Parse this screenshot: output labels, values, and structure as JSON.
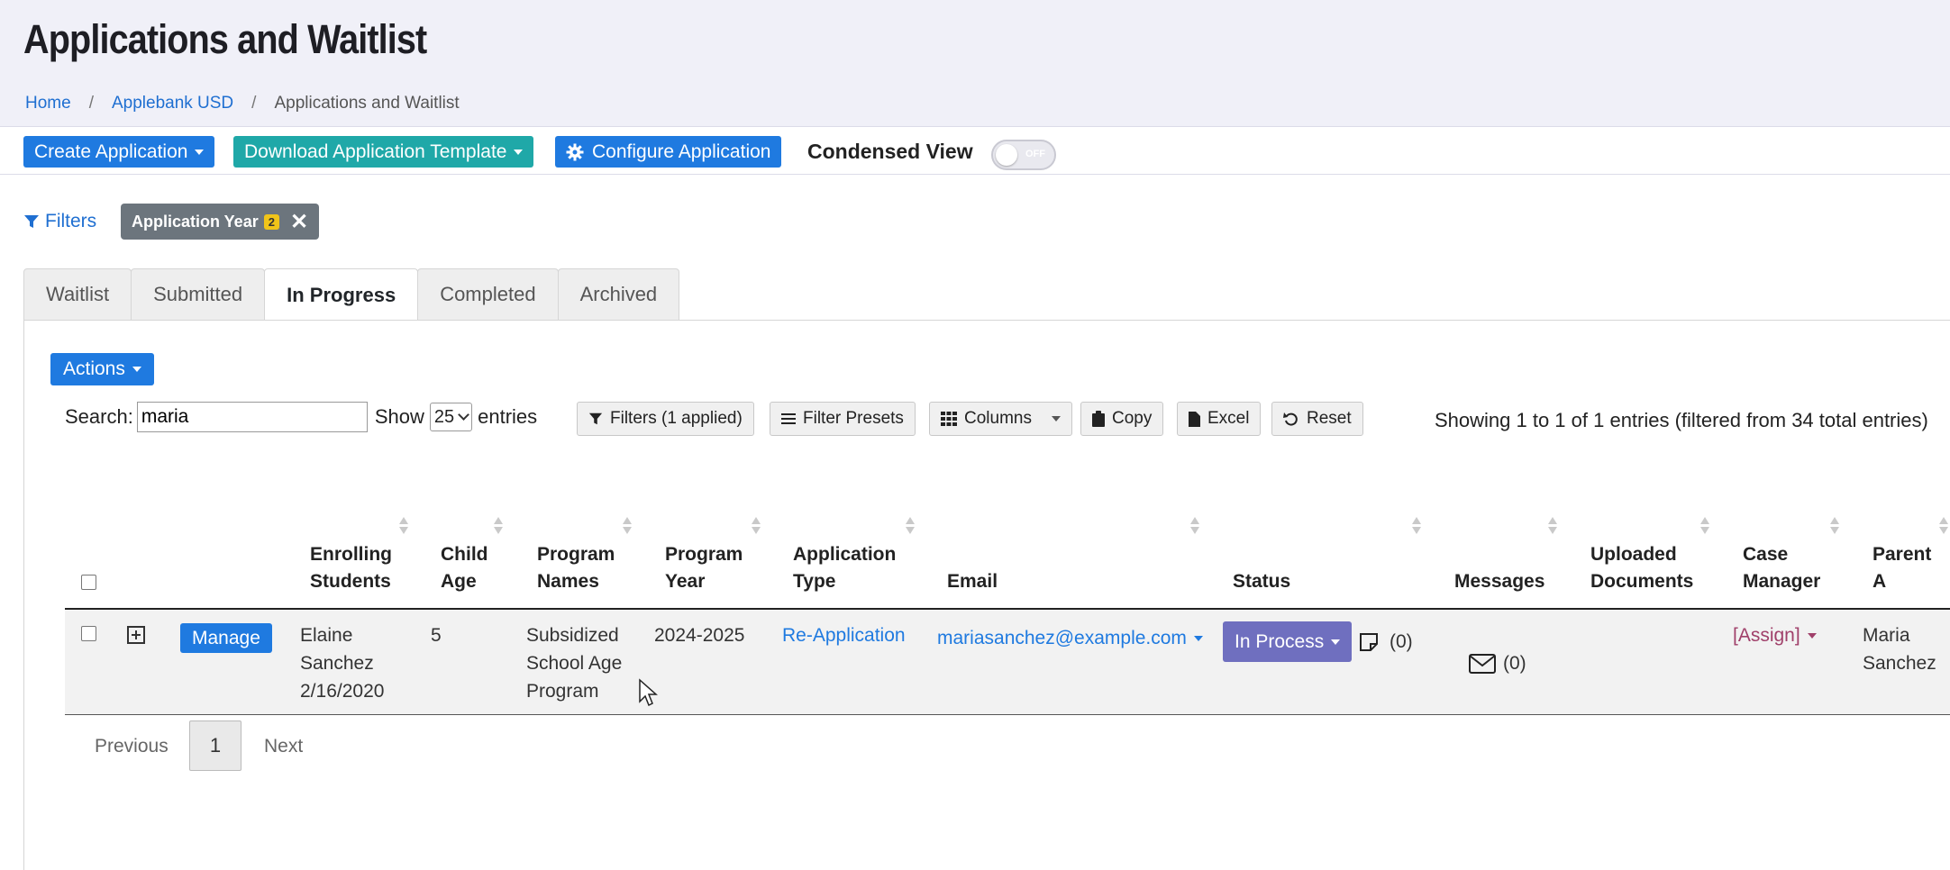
{
  "page": {
    "title": "Applications and Waitlist"
  },
  "breadcrumb": {
    "home": "Home",
    "district": "Applebank USD",
    "current": "Applications and Waitlist",
    "separator": "/"
  },
  "toolbar": {
    "create_application": "Create Application",
    "download_template": "Download Application Template",
    "configure_application": "Configure Application",
    "condensed_view": "Condensed View",
    "toggle_state": "OFF"
  },
  "filters": {
    "link_label": "Filters",
    "chip_label": "Application Year",
    "chip_count": "2"
  },
  "tabs": [
    {
      "label": "Waitlist"
    },
    {
      "label": "Submitted"
    },
    {
      "label": "In Progress"
    },
    {
      "label": "Completed"
    },
    {
      "label": "Archived"
    }
  ],
  "table_controls": {
    "actions": "Actions",
    "search_label": "Search:",
    "search_value": "maria",
    "show_label": "Show",
    "show_value": "25",
    "entries_label": "entries",
    "filters_applied": "Filters (1 applied)",
    "filter_presets": "Filter Presets",
    "columns": "Columns",
    "copy": "Copy",
    "excel": "Excel",
    "reset": "Reset",
    "info": "Showing 1 to 1 of 1 entries (filtered from 34 total entries)"
  },
  "columns": {
    "enrolling_students": [
      "Enrolling",
      "Students"
    ],
    "child_age": [
      "Child",
      "Age"
    ],
    "program_names": [
      "Program",
      "Names"
    ],
    "program_year": [
      "Program",
      "Year"
    ],
    "application_type": [
      "Application",
      "Type"
    ],
    "email": "Email",
    "status": "Status",
    "messages": "Messages",
    "uploaded_documents": [
      "Uploaded",
      "Documents"
    ],
    "case_manager": [
      "Case",
      "Manager"
    ],
    "parent_a": [
      "Parent",
      "A"
    ]
  },
  "row": {
    "manage": "Manage",
    "student_first": "Elaine",
    "student_last": "Sanchez",
    "student_dob": "2/16/2020",
    "child_age": "5",
    "program_line1": "Subsidized",
    "program_line2": "School Age",
    "program_line3": "Program",
    "program_year": "2024-2025",
    "application_type": "Re-Application",
    "email": "mariasanchez@example.com",
    "status": "In Process",
    "notes_count": "(0)",
    "messages_count": "(0)",
    "case_manager": "[Assign]",
    "parent_first": "Maria",
    "parent_last": "Sanchez"
  },
  "pagination": {
    "previous": "Previous",
    "current": "1",
    "next": "Next"
  },
  "colors": {
    "primary": "#1f7ae0",
    "teal": "#1fa8a8",
    "status": "#6f6fbf",
    "chip": "#6c757d",
    "assign": "#a0406a"
  }
}
